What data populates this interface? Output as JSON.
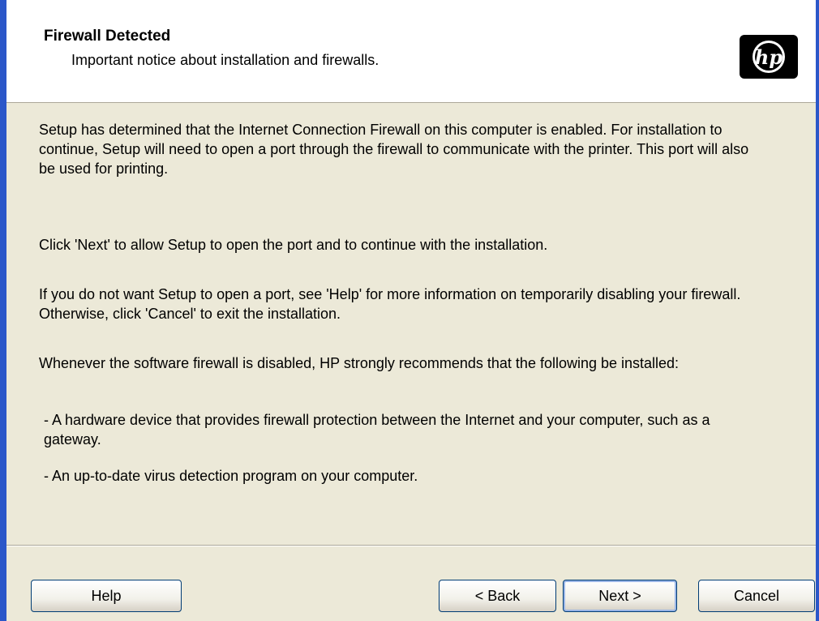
{
  "header": {
    "title": "Firewall Detected",
    "subtitle": "Important notice about installation and firewalls.",
    "logo_icon": "hp-logo"
  },
  "body": {
    "paragraph1": "Setup has determined that the Internet Connection Firewall on this computer is enabled.  For installation to continue, Setup will need to open a port through the firewall to communicate with the printer. This port will also be used for printing.",
    "paragraph2": "Click 'Next' to allow Setup to open the port and to continue with the installation.",
    "paragraph3": "If you do not want Setup to open a port, see 'Help' for more information on temporarily disabling your firewall.  Otherwise, click 'Cancel' to exit the installation.",
    "paragraph4": "Whenever the software firewall is disabled, HP strongly recommends that the following be installed:",
    "bullet1": "- A hardware device that provides firewall protection between the Internet and your computer, such as a gateway.",
    "bullet2": "- An up-to-date virus detection program on your computer."
  },
  "buttons": {
    "help": "Help",
    "back": "< Back",
    "next": "Next >",
    "cancel": "Cancel"
  },
  "colors": {
    "window_frame": "#2b57c9",
    "dialog_background": "#ece9d8",
    "header_background": "#ffffff",
    "button_border": "#003c74"
  }
}
